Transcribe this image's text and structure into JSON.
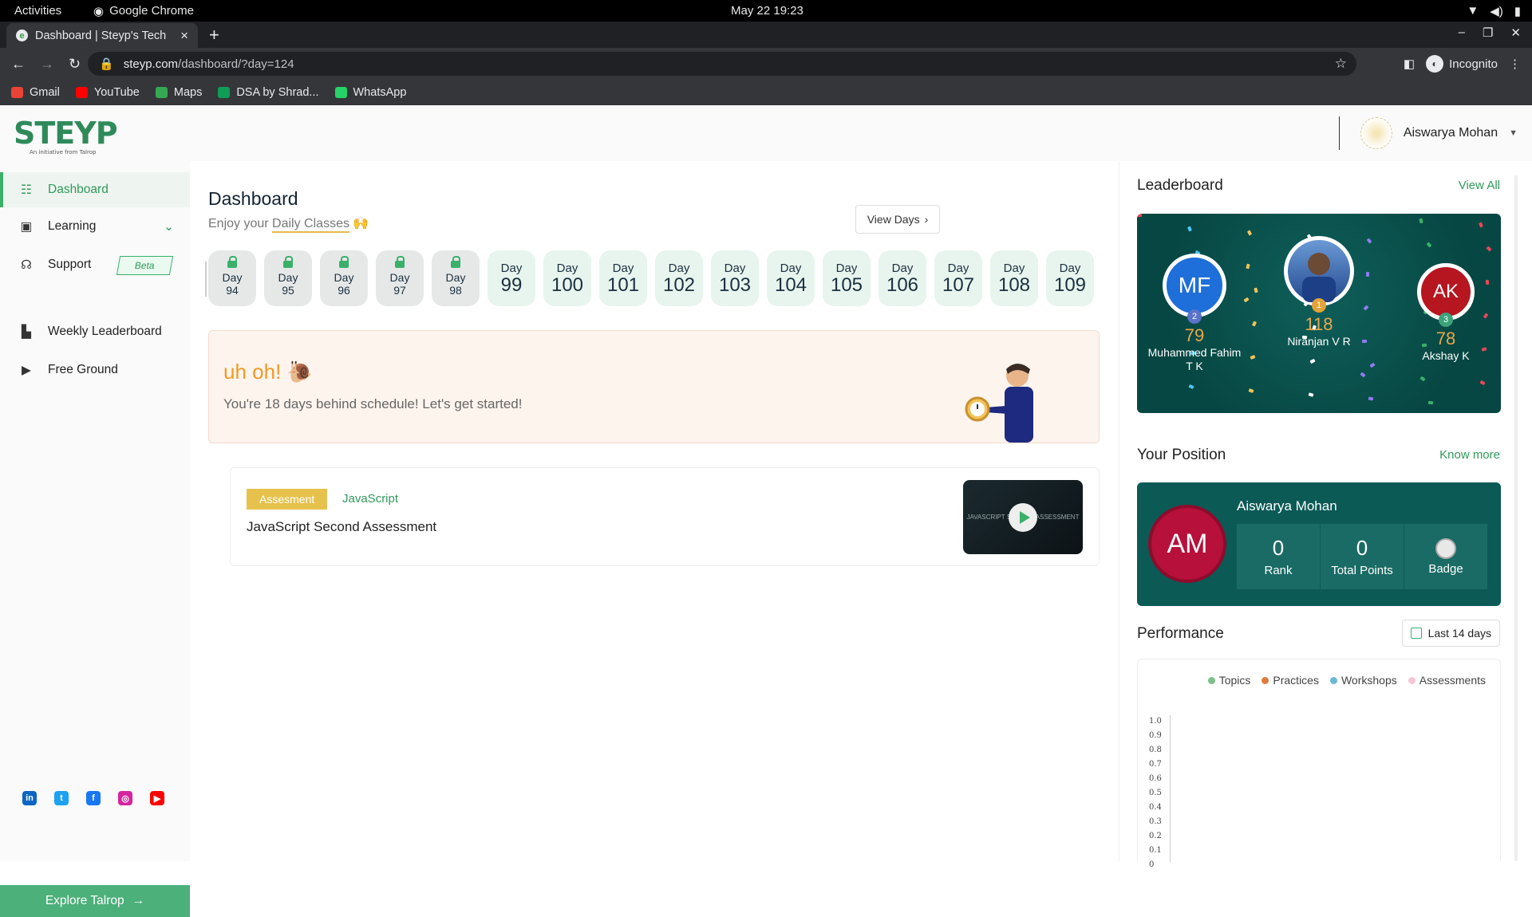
{
  "os": {
    "activities": "Activities",
    "app": "Google Chrome",
    "clock": "May 22  19:23"
  },
  "browser": {
    "tab_title": "Dashboard | Steyp's Tech",
    "url_host": "steyp.com",
    "url_path": "/dashboard/?day=124",
    "profile": "Incognito",
    "bookmarks": [
      {
        "label": "Gmail",
        "color": "#ea4335",
        "icon": "gmail-icon"
      },
      {
        "label": "YouTube",
        "color": "#ff0000",
        "icon": "youtube-icon"
      },
      {
        "label": "Maps",
        "color": "#34a853",
        "icon": "maps-icon"
      },
      {
        "label": "DSA by Shrad...",
        "color": "#0f9d58",
        "icon": "dsa-icon"
      },
      {
        "label": "WhatsApp",
        "color": "#25d366",
        "icon": "whatsapp-icon"
      }
    ]
  },
  "header": {
    "logo": "STEYP",
    "logo_sub": "An initiative from Talrop",
    "user_name": "Aiswarya Mohan"
  },
  "sidebar": {
    "items": [
      {
        "label": "Dashboard",
        "icon": "dashboard-icon"
      },
      {
        "label": "Learning",
        "icon": "learning-icon"
      },
      {
        "label": "Support",
        "icon": "support-icon"
      },
      {
        "label": "Weekly Leaderboard",
        "icon": "leaderboard-icon"
      },
      {
        "label": "Free Ground",
        "icon": "free-ground-icon"
      }
    ],
    "beta": "Beta",
    "explore": "Explore Talrop"
  },
  "main": {
    "title": "Dashboard",
    "subtitle_prefix": "Enjoy your ",
    "subtitle_link": "Daily Classes",
    "view_days": "View Days",
    "day_label": "Day",
    "locked_days": [
      "94",
      "95",
      "96",
      "97",
      "98"
    ],
    "open_days": [
      "99",
      "100",
      "101",
      "102",
      "103",
      "104",
      "105",
      "106",
      "107",
      "108",
      "109"
    ],
    "alert_title": "uh oh!",
    "alert_msg": "You're 18 days behind schedule! Let's get started!",
    "card": {
      "tag": "Assesment",
      "topic": "JavaScript",
      "title": "JavaScript Second Assessment",
      "thumb_text": "JAVASCRIPT SECOND ASSESSMENT"
    }
  },
  "right": {
    "leaderboard_title": "Leaderboard",
    "view_all": "View All",
    "podium": [
      {
        "initials": "MF",
        "rank": "2",
        "points": "79",
        "name": "Muhammed Fahim T K",
        "color": "#1e6fd9"
      },
      {
        "initials": "",
        "rank": "1",
        "points": "118",
        "name": "Niranjan V R",
        "color": "#2a3f6e"
      },
      {
        "initials": "AK",
        "rank": "3",
        "points": "78",
        "name": "Akshay K",
        "color": "#b5161f"
      }
    ],
    "position_title": "Your Position",
    "know_more": "Know more",
    "position": {
      "initials": "AM",
      "name": "Aiswarya Mohan",
      "rank": "0",
      "rank_label": "Rank",
      "points": "0",
      "points_label": "Total Points",
      "badge_label": "Badge"
    },
    "performance_title": "Performance",
    "range": "Last 14 days",
    "legend": [
      {
        "label": "Topics",
        "color": "#7cc08a"
      },
      {
        "label": "Practices",
        "color": "#e07b3c"
      },
      {
        "label": "Workshops",
        "color": "#6bb7d6"
      },
      {
        "label": "Assessments",
        "color": "#f6c6d4"
      }
    ],
    "yticks": [
      "1.0",
      "0.9",
      "0.8",
      "0.7",
      "0.6",
      "0.5",
      "0.4",
      "0.3",
      "0.2",
      "0.1",
      "0"
    ]
  }
}
